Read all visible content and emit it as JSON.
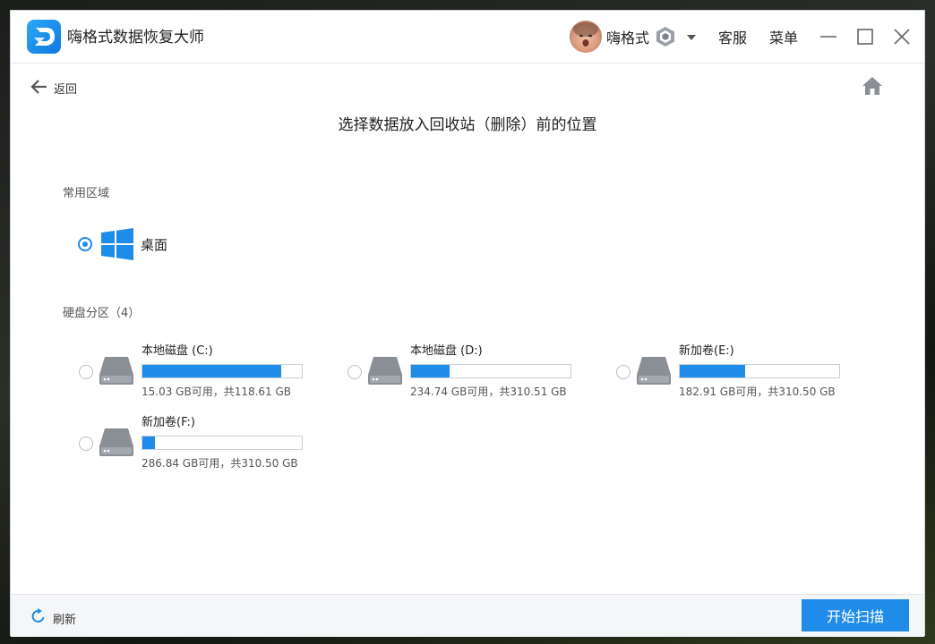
{
  "app": {
    "title": "嗨格式数据恢复大师",
    "username": "嗨格式",
    "links": {
      "support": "客服",
      "menu": "菜单"
    }
  },
  "nav": {
    "back_label": "返回"
  },
  "page": {
    "title": "选择数据放入回收站（删除）前的位置"
  },
  "common": {
    "label": "常用区域",
    "items": [
      {
        "label": "桌面",
        "selected": true
      }
    ]
  },
  "partitions": {
    "label": "硬盘分区（4）",
    "drives": [
      {
        "name": "本地磁盘 (C:)",
        "info": "15.03 GB可用，共118.61 GB",
        "used_fraction": 0.873,
        "selected": false
      },
      {
        "name": "本地磁盘 (D:)",
        "info": "234.74 GB可用，共310.51 GB",
        "used_fraction": 0.244,
        "selected": false
      },
      {
        "name": "新加卷(E:)",
        "info": "182.91 GB可用，共310.50 GB",
        "used_fraction": 0.411,
        "selected": false
      },
      {
        "name": "新加卷(F:)",
        "info": "286.84 GB可用，共310.50 GB",
        "used_fraction": 0.076,
        "selected": false
      }
    ]
  },
  "footer": {
    "refresh_label": "刷新",
    "scan_label": "开始扫描"
  },
  "colors": {
    "accent": "#1e8ce8",
    "icon_gray": "#8a8f96"
  },
  "icons": {
    "logo": "app-logo-icon",
    "vip": "vip-badge-icon",
    "dropdown": "chevron-down-icon",
    "minimize": "minimize-icon",
    "maximize": "maximize-icon",
    "close": "close-icon",
    "back": "arrow-left-icon",
    "home": "home-icon",
    "windows": "windows-logo-icon",
    "drive": "hard-drive-icon",
    "refresh": "refresh-icon"
  }
}
